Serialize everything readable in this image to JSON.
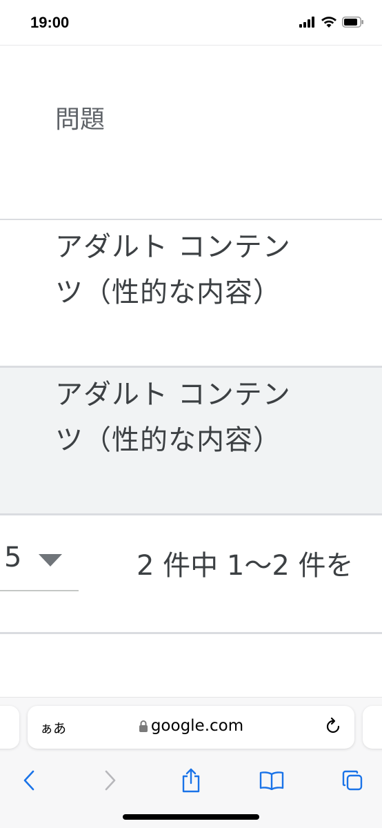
{
  "status_bar": {
    "time": "19:00"
  },
  "table": {
    "header": {
      "label": "問題"
    },
    "rows": [
      {
        "text": "アダルト コンテンツ（性的な内容）"
      },
      {
        "text": "アダルト コンテンツ（性的な内容）"
      }
    ]
  },
  "pagination": {
    "rows_per_page": "5",
    "range_text": "2 件中 1〜2 件を"
  },
  "browser": {
    "text_size_label": "ぁあ",
    "url": "google.com"
  },
  "icons": {
    "signal": "cellular-signal-icon",
    "wifi": "wifi-icon",
    "battery": "battery-icon",
    "caret": "dropdown-caret-icon",
    "lock": "lock-icon",
    "reload": "reload-icon",
    "back": "back-chevron-icon",
    "forward": "forward-chevron-icon",
    "share": "share-icon",
    "bookmarks": "book-icon",
    "tabs": "tabs-icon"
  },
  "colors": {
    "accent": "#1a73e8",
    "text": "#3c4043",
    "muted": "#5f6368",
    "alt_row": "#f1f3f4",
    "divider": "#dadce0"
  }
}
